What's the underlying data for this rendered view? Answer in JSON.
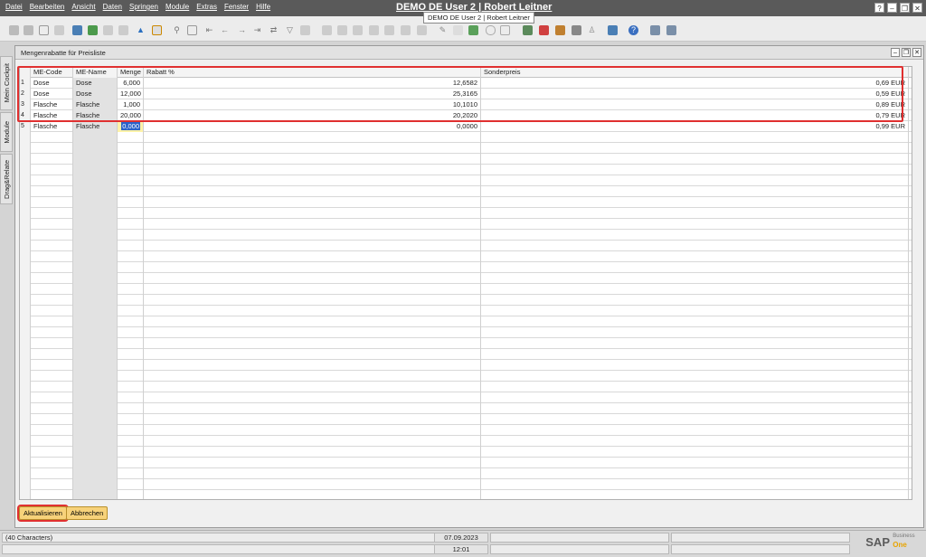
{
  "menu": [
    "Datei",
    "Bearbeiten",
    "Ansicht",
    "Daten",
    "Springen",
    "Module",
    "Extras",
    "Fenster",
    "Hilfe"
  ],
  "app_title": "DEMO DE User 2 | Robert Leitner",
  "tooltip": "DEMO DE User 2 | Robert Leitner",
  "side_tabs": [
    "Mein Cockpit",
    "Module",
    "Drag&Relate"
  ],
  "form": {
    "title": "Mengenrabatte für Preisliste",
    "columns": [
      "",
      "ME-Code",
      "ME-Name",
      "Menge",
      "Rabatt %",
      "Sonderpreis"
    ],
    "rows": [
      {
        "n": "1",
        "code": "Dose",
        "name": "Dose",
        "qty": "6,000",
        "rabatt": "12,6582",
        "preis": "0,69 EUR"
      },
      {
        "n": "2",
        "code": "Dose",
        "name": "Dose",
        "qty": "12,000",
        "rabatt": "25,3165",
        "preis": "0,59 EUR"
      },
      {
        "n": "3",
        "code": "Flasche",
        "name": "Flasche",
        "qty": "1,000",
        "rabatt": "10,1010",
        "preis": "0,89 EUR"
      },
      {
        "n": "4",
        "code": "Flasche",
        "name": "Flasche",
        "qty": "20,000",
        "rabatt": "20,2020",
        "preis": "0,79 EUR"
      },
      {
        "n": "5",
        "code": "Flasche",
        "name": "Flasche",
        "qty": "0,000",
        "rabatt": "0,0000",
        "preis": "0,99 EUR"
      }
    ],
    "update_button": "Aktualisieren",
    "cancel_button": "Abbrechen"
  },
  "status": {
    "message": "(40 Characters)",
    "date": "07.09.2023",
    "time": "12:01"
  },
  "logo": {
    "name": "SAP",
    "line1": "Business",
    "line2": "One"
  }
}
